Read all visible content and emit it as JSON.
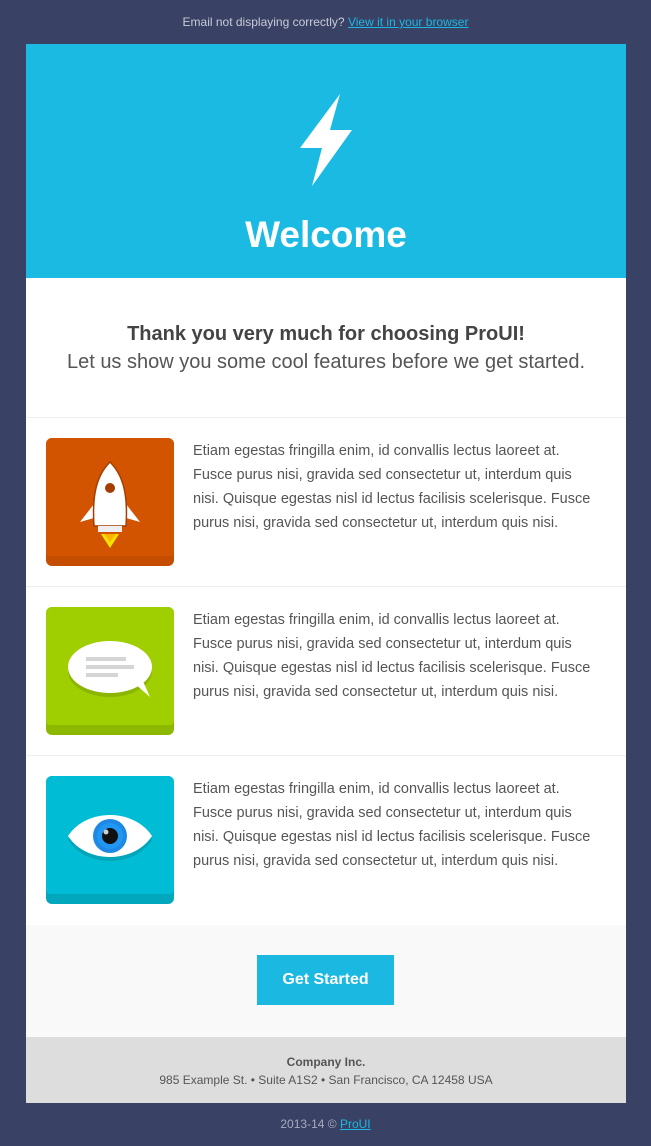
{
  "topbar": {
    "text": "Email not displaying correctly?",
    "link": "View it in your browser"
  },
  "hero": {
    "icon": "lightning-bolt-icon",
    "title": "Welcome"
  },
  "intro": {
    "heading": "Thank you very much for choosing ProUI!",
    "subheading": "Let us show you some cool features before we get started."
  },
  "features": [
    {
      "icon": "rocket-icon",
      "color": "#d35400",
      "text": "Etiam egestas fringilla enim, id convallis lectus laoreet at. Fusce purus nisi, gravida sed consectetur ut, interdum quis nisi. Quisque egestas nisl id lectus facilisis scelerisque. Fusce purus nisi, gravida sed consectetur ut, interdum quis nisi."
    },
    {
      "icon": "chat-bubble-icon",
      "color": "#9fcf00",
      "text": "Etiam egestas fringilla enim, id convallis lectus laoreet at. Fusce purus nisi, gravida sed consectetur ut, interdum quis nisi. Quisque egestas nisl id lectus facilisis scelerisque. Fusce purus nisi, gravida sed consectetur ut, interdum quis nisi."
    },
    {
      "icon": "eye-icon",
      "color": "#00bcd4",
      "text": "Etiam egestas fringilla enim, id convallis lectus laoreet at. Fusce purus nisi, gravida sed consectetur ut, interdum quis nisi. Quisque egestas nisl id lectus facilisis scelerisque. Fusce purus nisi, gravida sed consectetur ut, interdum quis nisi."
    }
  ],
  "cta": {
    "label": "Get Started"
  },
  "company": {
    "name": "Company Inc.",
    "address": "985 Example St. • Suite A1S2 • San Francisco, CA 12458 USA"
  },
  "footer": {
    "copyright": "2013-14 ©",
    "link": "ProUI"
  },
  "colors": {
    "background": "#394264",
    "accent": "#1bb8e2",
    "hero": "#1bbae2"
  }
}
